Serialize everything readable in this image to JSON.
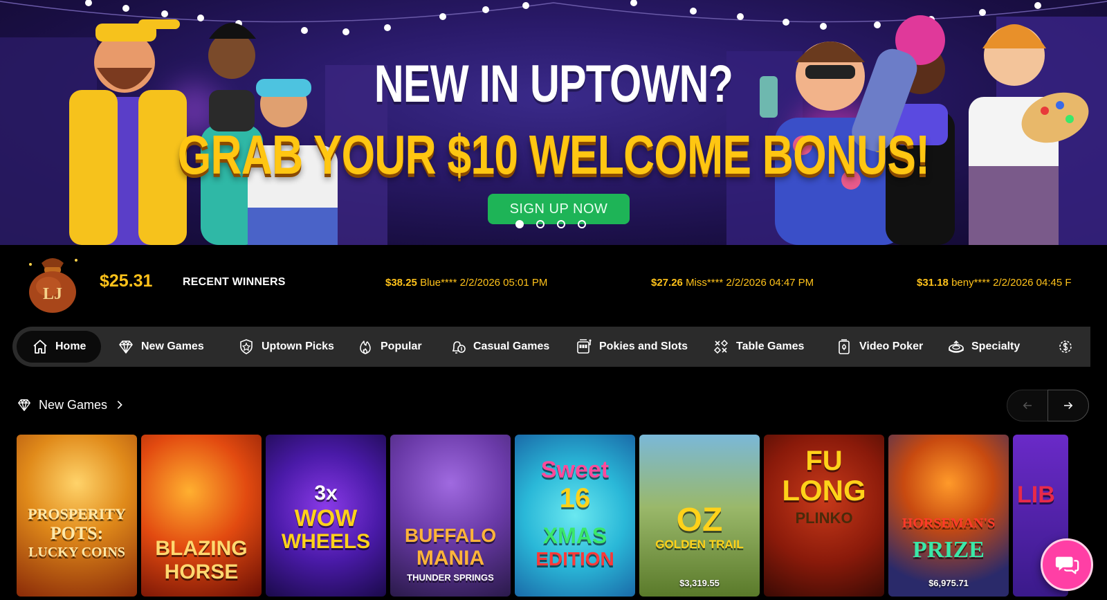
{
  "banner": {
    "headline": "NEW IN UPTOWN?",
    "subheadline": "GRAB YOUR $10 WELCOME BONUS!",
    "cta_label": "SIGN UP NOW",
    "slide_count": 4,
    "active_slide": 1
  },
  "ticker": {
    "jackpot_badge": "LJ",
    "jackpot_amount": "$25.31",
    "recent_winners_label": "RECENT WINNERS",
    "winners": [
      {
        "amount": "$38.25",
        "name": "Blue****",
        "datetime": "2/2/2026 05:01 PM"
      },
      {
        "amount": "$27.26",
        "name": "Miss****",
        "datetime": "2/2/2026 04:47 PM"
      },
      {
        "amount": "$31.18",
        "name": "beny****",
        "datetime": "2/2/2026 04:45 F"
      }
    ]
  },
  "categories": [
    {
      "label": "Home",
      "icon": "home-icon",
      "active": true
    },
    {
      "label": "New Games",
      "icon": "diamond-icon"
    },
    {
      "label": "Uptown Picks",
      "icon": "star-badge-icon"
    },
    {
      "label": "Popular",
      "icon": "flame-icon"
    },
    {
      "label": "Casual Games",
      "icon": "bell-coin-icon"
    },
    {
      "label": "Pokies and Slots",
      "icon": "slot-machine-icon"
    },
    {
      "label": "Table Games",
      "icon": "cards-icon"
    },
    {
      "label": "Video Poker",
      "icon": "poker-icon"
    },
    {
      "label": "Specialty",
      "icon": "specialty-icon"
    }
  ],
  "section": {
    "title": "New Games",
    "icon": "diamond-icon"
  },
  "games": [
    {
      "title_lines": [
        "PROSPERITY",
        "POTS:",
        "LUCKY COINS"
      ],
      "jackpot": ""
    },
    {
      "title_lines": [
        "BLAZING",
        "HORSE"
      ],
      "jackpot": ""
    },
    {
      "title_lines": [
        "3x",
        "WOW",
        "WHEELS"
      ],
      "jackpot": ""
    },
    {
      "title_lines": [
        "BUFFALO",
        "MANIA",
        "THUNDER SPRINGS"
      ],
      "jackpot": ""
    },
    {
      "title_lines": [
        "Sweet",
        "16",
        "XMAS",
        "EDITION"
      ],
      "jackpot": ""
    },
    {
      "title_lines": [
        "OZ",
        "GOLDEN TRAIL"
      ],
      "jackpot": "$3,319.55"
    },
    {
      "title_lines": [
        "FU",
        "LONG",
        "PLINKO"
      ],
      "jackpot": ""
    },
    {
      "title_lines": [
        "HORSEMAN'S",
        "PRIZE"
      ],
      "jackpot": "$6,975.71"
    },
    {
      "title_lines": [
        "LIB"
      ],
      "jackpot": ""
    }
  ],
  "colors": {
    "accent_gold": "#ffc21a",
    "cta_green": "#1eb457",
    "chat_pink": "#ff3fa5",
    "nav_bg": "#2b2b2b"
  }
}
